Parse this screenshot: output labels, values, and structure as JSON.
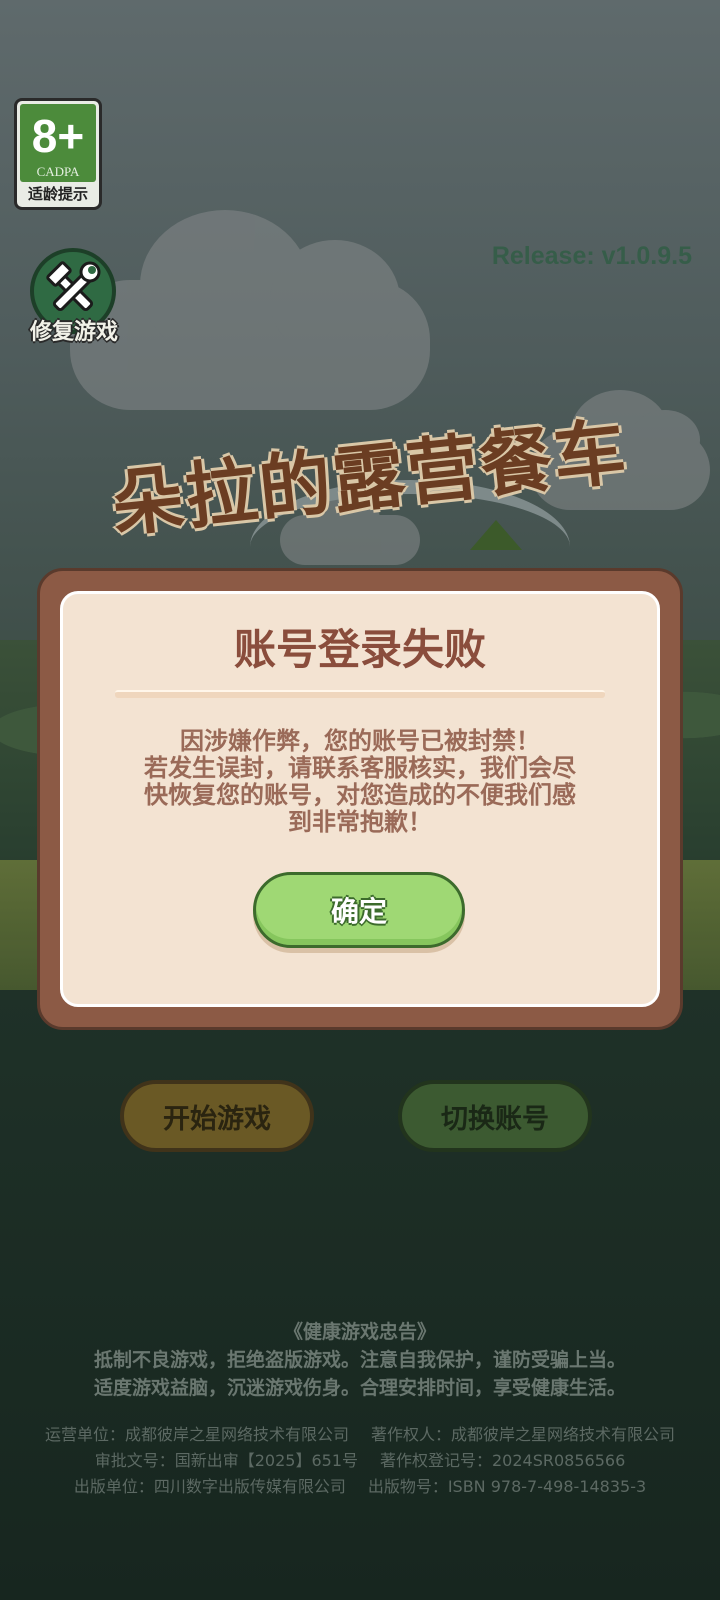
{
  "age_badge": {
    "rating": "8+",
    "org": "CADPA",
    "label": "适龄提示"
  },
  "repair": {
    "label": "修复游戏"
  },
  "release": "Release: v1.0.9.5",
  "logo": {
    "title": "朵拉的露营餐车"
  },
  "dialog": {
    "title": "账号登录失败",
    "message_lines": [
      "因涉嫌作弊，您的账号已被封禁！",
      "若发生误封，请联系客服核实，我们会尽",
      "快恢复您的账号，对您造成的不便我们感",
      "到非常抱歉！"
    ],
    "confirm": "确定"
  },
  "buttons": {
    "start": "开始游戏",
    "switch": "切换账号"
  },
  "health": {
    "title": "《健康游戏忠告》",
    "line1": "抵制不良游戏，拒绝盗版游戏。注意自我保护，谨防受骗上当。",
    "line2": "适度游戏益脑，沉迷游戏伤身。合理安排时间，享受健康生活。"
  },
  "credits": {
    "operator": "运营单位：成都彼岸之星网络技术有限公司",
    "copyright_owner": "著作权人：成都彼岸之星网络技术有限公司",
    "approval": "审批文号：国新出审【2025】651号",
    "copyright_reg": "著作权登记号：2024SR0856566",
    "publisher": "出版单位：四川数字出版传媒有限公司",
    "isbn": "出版物号：ISBN 978-7-498-14835-3"
  },
  "colors": {
    "dialog_frame": "#8c5a45",
    "dialog_bg": "#f3e3d2",
    "confirm_green": "#9fd874",
    "title_brown": "#8a4d3c"
  },
  "icons": {
    "repair": "wrench-hammer-icon"
  }
}
